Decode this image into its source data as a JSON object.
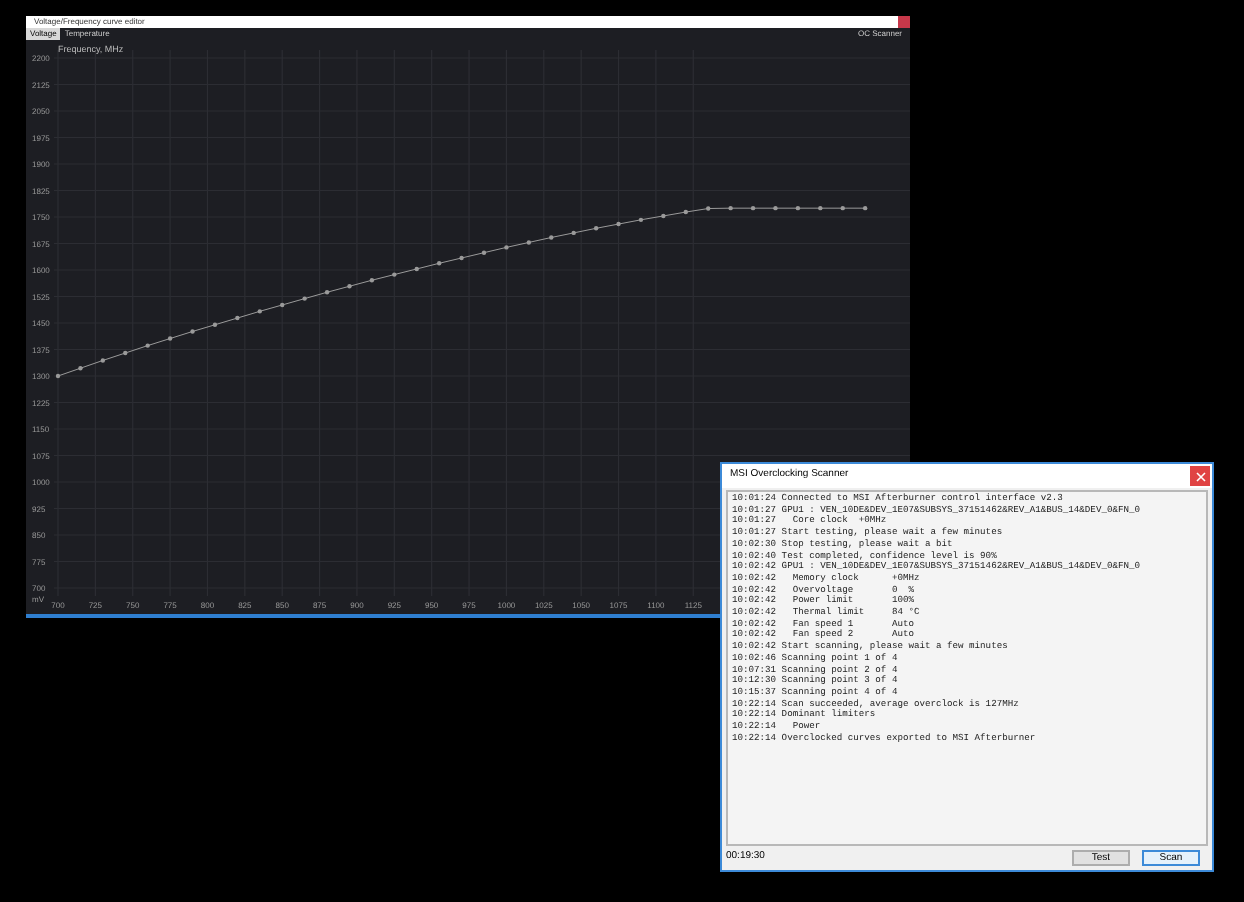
{
  "curve_window": {
    "title": "Voltage/Frequency curve editor",
    "tabs": [
      {
        "label": "Voltage",
        "selected": true
      },
      {
        "label": "Temperature",
        "selected": false
      }
    ],
    "mode_label": "OC Scanner",
    "chart_data": {
      "type": "line",
      "grid": true,
      "ylabel": "Frequency, MHz",
      "xlabel": "mV",
      "x": [
        700,
        715,
        730,
        745,
        760,
        775,
        790,
        805,
        820,
        835,
        850,
        865,
        880,
        895,
        910,
        925,
        940,
        955,
        970,
        985,
        1000,
        1015,
        1030,
        1045,
        1060,
        1075,
        1090,
        1105,
        1120,
        1135,
        1150,
        1165,
        1180,
        1195,
        1210,
        1225,
        1240
      ],
      "series": [
        {
          "color": "#9a9a9a",
          "values": [
            1300,
            1322,
            1344,
            1365,
            1386,
            1406,
            1426,
            1445,
            1464,
            1483,
            1501,
            1519,
            1537,
            1554,
            1571,
            1587,
            1603,
            1619,
            1634,
            1649,
            1664,
            1678,
            1692,
            1705,
            1718,
            1730,
            1742,
            1753,
            1764,
            1774,
            1775,
            1775,
            1775,
            1775,
            1775,
            1775,
            1775
          ]
        }
      ],
      "xlim": [
        700,
        1270
      ],
      "ylim": [
        700,
        2200
      ],
      "xticks": [
        700,
        725,
        750,
        775,
        800,
        825,
        850,
        875,
        900,
        925,
        950,
        975,
        1000,
        1025,
        1050,
        1075,
        1100,
        1125
      ],
      "yticks": [
        2200,
        2125,
        2050,
        1975,
        1900,
        1825,
        1750,
        1675,
        1600,
        1525,
        1450,
        1375,
        1300,
        1225,
        1150,
        1075,
        1000,
        925,
        850,
        775,
        700
      ]
    }
  },
  "scanner_window": {
    "title": "MSI Overclocking Scanner",
    "log": [
      "10:01:24 Connected to MSI Afterburner control interface v2.3",
      "10:01:27 GPU1 : VEN_10DE&DEV_1E07&SUBSYS_37151462&REV_A1&BUS_14&DEV_0&FN_0",
      "10:01:27   Core clock  +0MHz",
      "10:01:27 Start testing, please wait a few minutes",
      "10:02:30 Stop testing, please wait a bit",
      "10:02:40 Test completed, confidence level is 90%",
      "10:02:42 GPU1 : VEN_10DE&DEV_1E07&SUBSYS_37151462&REV_A1&BUS_14&DEV_0&FN_0",
      "10:02:42   Memory clock      +0MHz",
      "10:02:42   Overvoltage       0  %",
      "10:02:42   Power limit       100%",
      "10:02:42   Thermal limit     84 °C",
      "10:02:42   Fan speed 1       Auto",
      "10:02:42   Fan speed 2       Auto",
      "10:02:42 Start scanning, please wait a few minutes",
      "10:02:46 Scanning point 1 of 4",
      "10:07:31 Scanning point 2 of 4",
      "10:12:30 Scanning point 3 of 4",
      "10:15:37 Scanning point 4 of 4",
      "10:22:14 Scan succeeded, average overclock is 127MHz",
      "10:22:14 Dominant limiters",
      "10:22:14   Power",
      "10:22:14 Overclocked curves exported to MSI Afterburner"
    ],
    "elapsed": "00:19:30",
    "buttons": [
      {
        "label": "Test",
        "focused": false
      },
      {
        "label": "Scan",
        "focused": true
      }
    ]
  }
}
